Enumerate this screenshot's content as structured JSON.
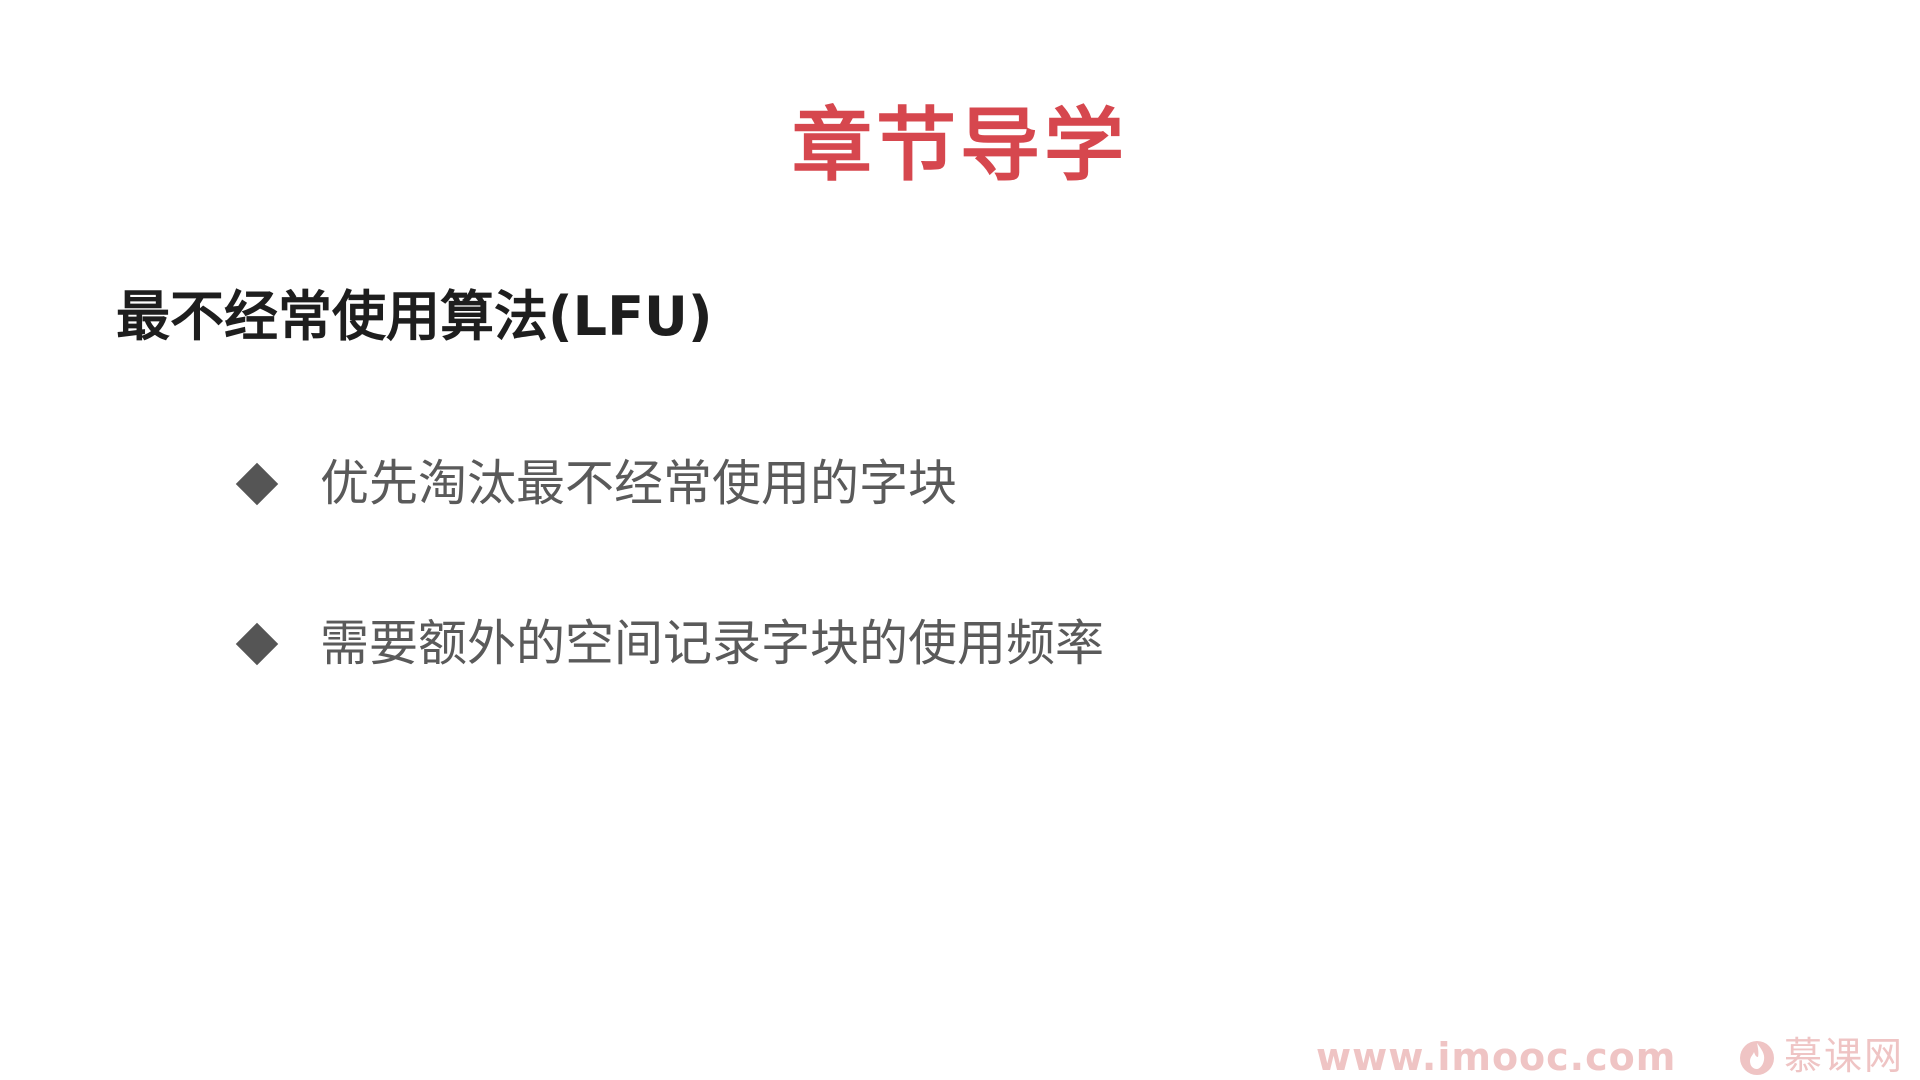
{
  "slide": {
    "title": "章节导学",
    "heading": "最不经常使用算法(LFU)",
    "bullets": [
      {
        "text": "优先淘汰最不经常使用的字块"
      },
      {
        "text": "需要额外的空间记录字块的使用频率"
      }
    ]
  },
  "watermark": {
    "url": "www.imooc.com",
    "brand": "慕课网",
    "icon": "flame-icon"
  },
  "colors": {
    "title": "#d6474e",
    "heading": "#1e1e1e",
    "bullet_text": "#5a5a5a",
    "bullet_marker": "#555555",
    "watermark": "#efc4c4",
    "background": "#ffffff"
  }
}
